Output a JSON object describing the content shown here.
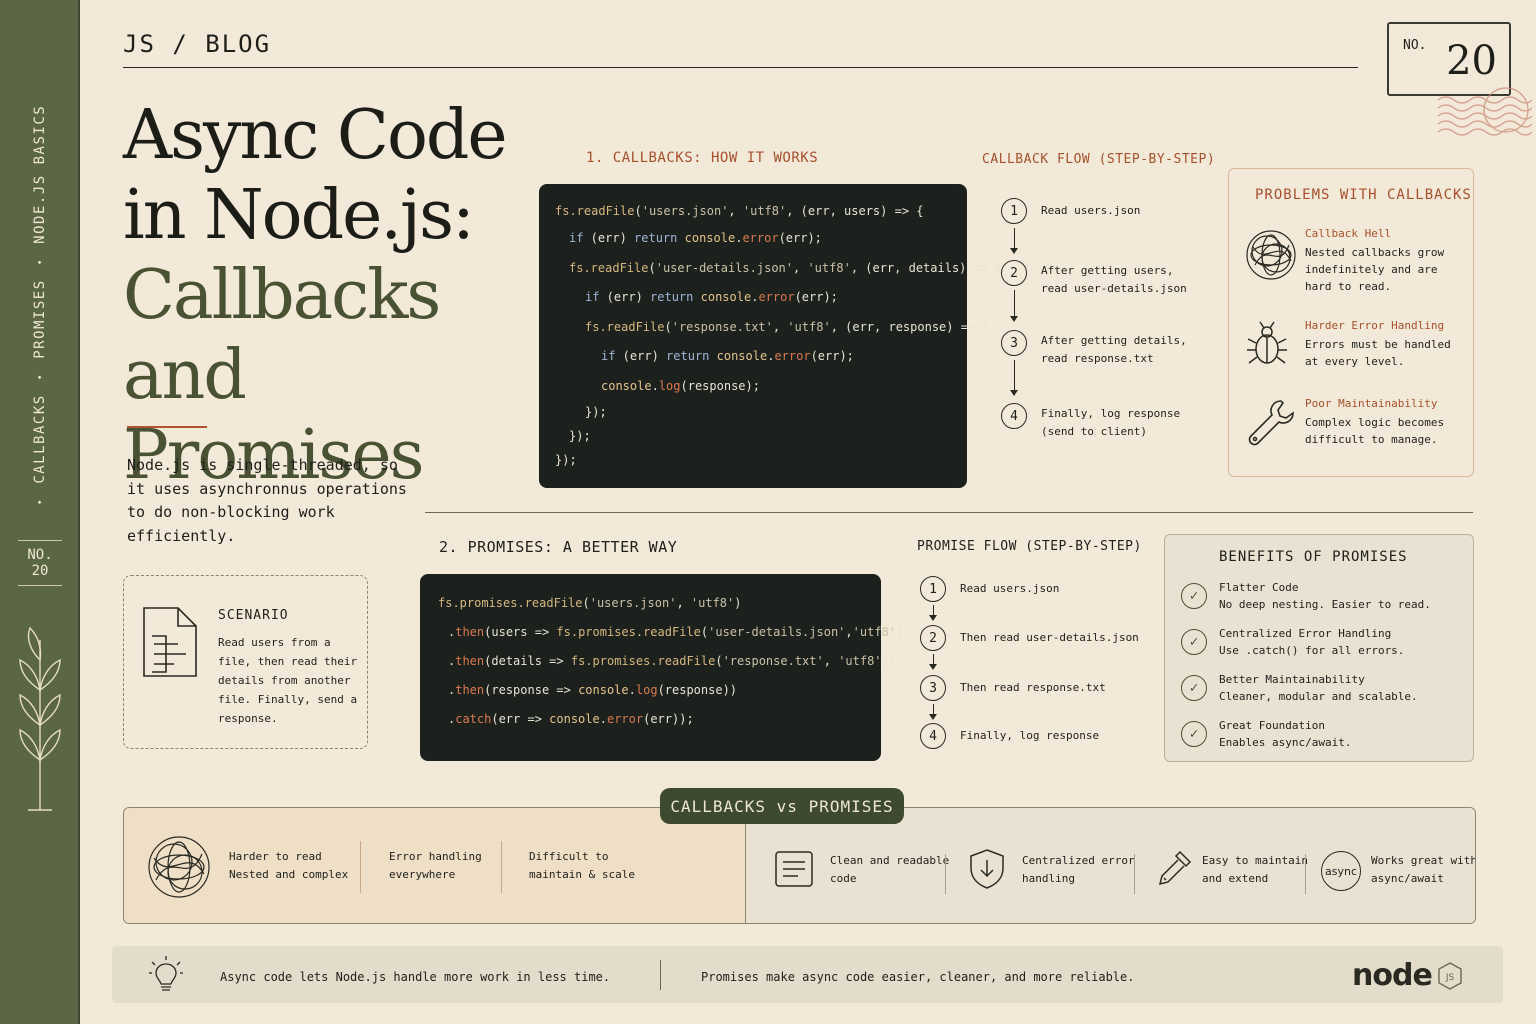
{
  "sidebar": {
    "vertical_items": [
      "CALLBACKS",
      "PROMISES",
      "NODE.JS BASICS"
    ],
    "no_label": "NO.",
    "no_value": "20"
  },
  "header": {
    "label": "JS / BLOG",
    "stamp_no": "NO.",
    "stamp_num": "20"
  },
  "title": {
    "line1": "Async Code",
    "line2": "in Node.js:",
    "line3": "Callbacks and",
    "line4": "Promises"
  },
  "intro": "Node.js is single-threaded, so it uses asynchronnus operations to do non-blocking work efficiently.",
  "scenario": {
    "title": "SCENARIO",
    "text": "Read users from a file, then read their details from another file. Finally, send a response."
  },
  "section1": {
    "label_num": "1. CALLBACKS:",
    "label_rest": " HOW IT WORKS",
    "flow_title": "CALLBACK FLOW (STEP-BY-STEP)",
    "flow_steps": [
      {
        "n": "1",
        "text": "Read users.json"
      },
      {
        "n": "2",
        "text": "After getting users, read user-details.json"
      },
      {
        "n": "3",
        "text": "After getting details, read response.txt"
      },
      {
        "n": "4",
        "text": "Finally, log response (send to client)"
      }
    ]
  },
  "problems": {
    "title": "PROBLEMS WITH CALLBACKS",
    "items": [
      {
        "head": "Callback Hell",
        "body": "Nested callbacks grow indefinitely and are hard to read.",
        "icon": "tangle-icon"
      },
      {
        "head": "Harder Error Handling",
        "body": "Errors must be handled at every level.",
        "icon": "bug-icon"
      },
      {
        "head": "Poor Maintainability",
        "body": "Complex logic becomes difficult to manage.",
        "icon": "wrench-icon"
      }
    ]
  },
  "section2": {
    "label": "2. PROMISES: A BETTER WAY",
    "flow_title": "PROMISE FLOW (STEP-BY-STEP)",
    "flow_steps": [
      {
        "n": "1",
        "text": "Read users.json"
      },
      {
        "n": "2",
        "text": "Then read user-details.json"
      },
      {
        "n": "3",
        "text": "Then read response.txt"
      },
      {
        "n": "4",
        "text": "Finally, log response"
      }
    ]
  },
  "benefits": {
    "title": "BENEFITS OF PROMISES",
    "items": [
      {
        "head": "Flatter Code",
        "body": "No deep nesting. Easier to read."
      },
      {
        "head": "Centralized Error Handling",
        "body": "Use .catch() for all errors."
      },
      {
        "head": "Better Maintainability",
        "body": "Cleaner, modular and scalable."
      },
      {
        "head": "Great Foundation",
        "body": "Enables async/await."
      }
    ]
  },
  "compare": {
    "pill": "CALLBACKS vs PROMISES",
    "left": [
      {
        "line1": "Harder to read",
        "line2": "Nested and complex"
      },
      {
        "line1": "Error handling",
        "line2": "everywhere"
      },
      {
        "line1": "Difficult to",
        "line2": "maintain & scale"
      }
    ],
    "right": [
      {
        "line1": "Clean and readable",
        "line2": "code",
        "icon": "document-lines-icon"
      },
      {
        "line1": "Centralized error",
        "line2": "handling",
        "icon": "shield-arrow-icon"
      },
      {
        "line1": "Easy to maintain",
        "line2": "and extend",
        "icon": "tool-icon"
      },
      {
        "line1": "Works great with",
        "line2": "async/await",
        "icon": "async-badge-icon"
      }
    ],
    "async_badge": "async"
  },
  "footer": {
    "left": "Async code lets Node.js handle more work in less time.",
    "right": "Promises make async code easier, cleaner, and more reliable.",
    "logo_text": "node",
    "logo_badge": "JS"
  },
  "colors": {
    "background": "#f3e9d9",
    "sidebar": "#5b6645",
    "accent": "#a8502c",
    "code_bg": "#1d211e",
    "olive": "#4a5234"
  }
}
